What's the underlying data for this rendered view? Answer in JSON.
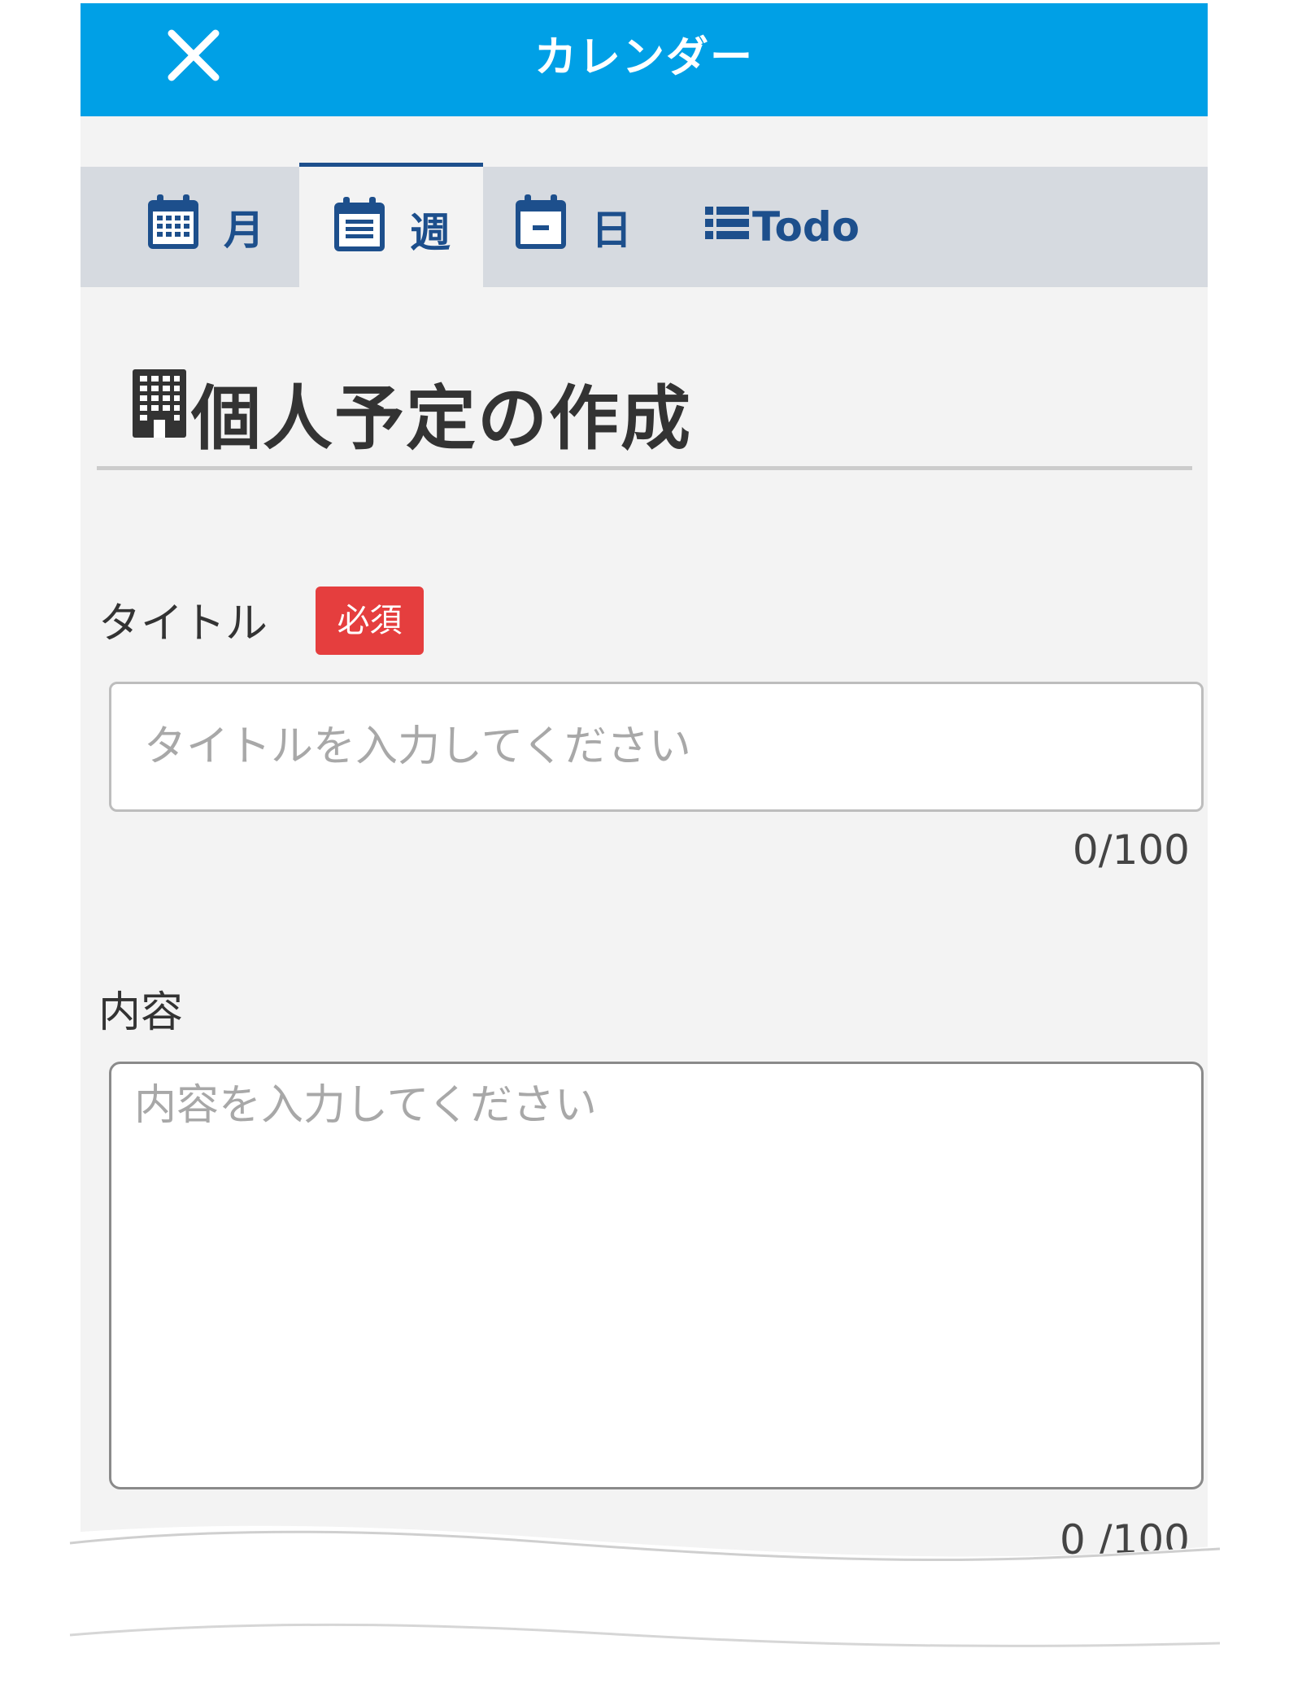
{
  "header": {
    "title": "カレンダー",
    "close_icon": "close-icon"
  },
  "tabs": [
    {
      "id": "month",
      "label": "月",
      "icon": "calendar-month-icon",
      "active": false
    },
    {
      "id": "week",
      "label": "週",
      "icon": "calendar-week-icon",
      "active": true
    },
    {
      "id": "day",
      "label": "日",
      "icon": "calendar-day-icon",
      "active": false
    },
    {
      "id": "todo",
      "label": "Todo",
      "icon": "list-icon",
      "active": false
    }
  ],
  "page": {
    "title": "個人予定の作成",
    "title_icon": "building-icon"
  },
  "form": {
    "title_field": {
      "label": "タイトル",
      "required_badge": "必須",
      "placeholder": "タイトルを入力してください",
      "value": "",
      "counter": "0/100"
    },
    "content_field": {
      "label": "内容",
      "placeholder": "内容を入力してください",
      "value": "",
      "counter": "0 /100"
    }
  },
  "colors": {
    "header_bg": "#00a0e6",
    "tab_bar_bg": "#d6dae0",
    "tab_text": "#1d4f8c",
    "required_badge_bg": "#e53e3e",
    "page_bg": "#f3f3f3"
  }
}
